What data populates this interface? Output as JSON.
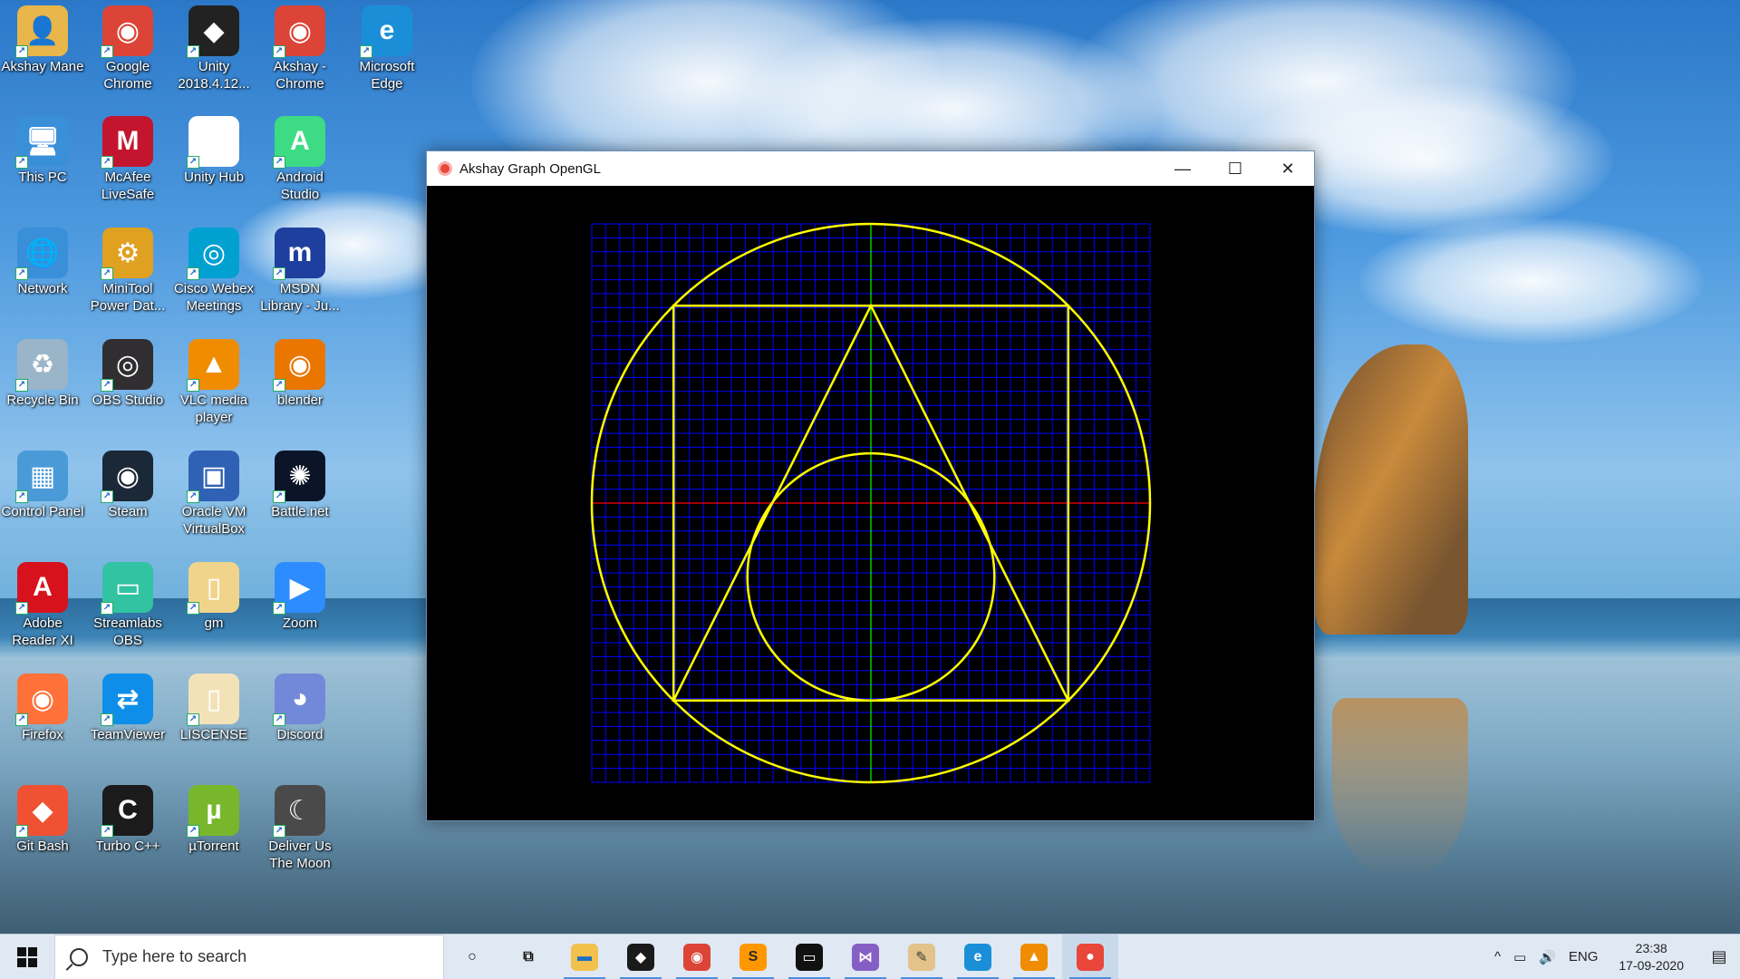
{
  "desktop": {
    "icons": [
      {
        "label": "Akshay Mane",
        "icon": "user-folder-icon",
        "color": "#e8b64a",
        "sym": "👤"
      },
      {
        "label": "Google Chrome",
        "icon": "chrome-icon",
        "color": "#db4437",
        "sym": "◉"
      },
      {
        "label": "Unity 2018.4.12...",
        "icon": "unity-icon",
        "color": "#222222",
        "sym": "◆"
      },
      {
        "label": "Akshay - Chrome",
        "icon": "chrome-profile-icon",
        "color": "#db4437",
        "sym": "◉"
      },
      {
        "label": "Microsoft Edge",
        "icon": "edge-icon",
        "color": "#1a8fd8",
        "sym": "e"
      },
      {
        "label": "This PC",
        "icon": "computer-icon",
        "color": "#3a8fd9",
        "sym": "🖥"
      },
      {
        "label": "McAfee LiveSafe",
        "icon": "mcafee-icon",
        "color": "#c3162e",
        "sym": "M"
      },
      {
        "label": "Unity Hub",
        "icon": "unity-hub-icon",
        "color": "#ffffff",
        "sym": "◆"
      },
      {
        "label": "Android Studio",
        "icon": "android-studio-icon",
        "color": "#3ddc84",
        "sym": "A"
      },
      {
        "label": "Network",
        "icon": "network-icon",
        "color": "#3a8fd9",
        "sym": "🌐"
      },
      {
        "label": "MiniTool Power Dat...",
        "icon": "minitool-icon",
        "color": "#e0a020",
        "sym": "⚙"
      },
      {
        "label": "Cisco Webex Meetings",
        "icon": "webex-icon",
        "color": "#00a0d1",
        "sym": "◎"
      },
      {
        "label": "MSDN Library - Ju...",
        "icon": "msdn-icon",
        "color": "#1e3f9e",
        "sym": "m"
      },
      {
        "label": "Recycle Bin",
        "icon": "recycle-bin-icon",
        "color": "#9ab4c8",
        "sym": "♻"
      },
      {
        "label": "OBS Studio",
        "icon": "obs-icon",
        "color": "#302e31",
        "sym": "◎"
      },
      {
        "label": "VLC media player",
        "icon": "vlc-icon",
        "color": "#f08c00",
        "sym": "▲"
      },
      {
        "label": "blender",
        "icon": "blender-icon",
        "color": "#ea7600",
        "sym": "◉"
      },
      {
        "label": "Control Panel",
        "icon": "control-panel-icon",
        "color": "#4a9ad8",
        "sym": "▦"
      },
      {
        "label": "Steam",
        "icon": "steam-icon",
        "color": "#1b2838",
        "sym": "◉"
      },
      {
        "label": "Oracle VM VirtualBox",
        "icon": "virtualbox-icon",
        "color": "#2f61b4",
        "sym": "▣"
      },
      {
        "label": "Battle.net",
        "icon": "battlenet-icon",
        "color": "#0c1428",
        "sym": "✺"
      },
      {
        "label": "Adobe Reader XI",
        "icon": "adobe-reader-icon",
        "color": "#d7121d",
        "sym": "A"
      },
      {
        "label": "Streamlabs OBS",
        "icon": "streamlabs-icon",
        "color": "#31c3a2",
        "sym": "▭"
      },
      {
        "label": "gm",
        "icon": "file-icon",
        "color": "#f1d48b",
        "sym": "▯"
      },
      {
        "label": "Zoom",
        "icon": "zoom-icon",
        "color": "#2d8cff",
        "sym": "▶"
      },
      {
        "label": "Firefox",
        "icon": "firefox-icon",
        "color": "#ff7139",
        "sym": "◉"
      },
      {
        "label": "TeamViewer",
        "icon": "teamviewer-icon",
        "color": "#0e8ee9",
        "sym": "⇄"
      },
      {
        "label": "LISCENSE",
        "icon": "pdf-file-icon",
        "color": "#f3e2b8",
        "sym": "▯"
      },
      {
        "label": "Discord",
        "icon": "discord-icon",
        "color": "#7289da",
        "sym": "◕"
      },
      {
        "label": "Git Bash",
        "icon": "git-bash-icon",
        "color": "#f05133",
        "sym": "◆"
      },
      {
        "label": "Turbo C++",
        "icon": "turbo-cpp-icon",
        "color": "#1b1b1b",
        "sym": "C"
      },
      {
        "label": "µTorrent",
        "icon": "utorrent-icon",
        "color": "#78b72c",
        "sym": "µ"
      },
      {
        "label": "Deliver Us The Moon",
        "icon": "deliver-us-the-moon-icon",
        "color": "#4a4a4a",
        "sym": "☾"
      }
    ]
  },
  "window": {
    "title": "Akshay Graph OpenGL",
    "minimize": "—",
    "maximize": "☐",
    "close": "✕"
  },
  "graph": {
    "background": "#000000",
    "grid_color": "#0000ff",
    "x_axis_color": "#ff0000",
    "y_axis_color": "#00ff00",
    "shape_color": "#ffff00",
    "grid_range": [
      -20,
      20
    ],
    "outer_circle_radius": 20,
    "square_half_side": 14.14,
    "triangle": [
      [
        0,
        14.14
      ],
      [
        -14.14,
        -14.14
      ],
      [
        14.14,
        -14.14
      ]
    ],
    "inner_circle": {
      "cx": 0,
      "cy": -5.29,
      "r": 8.85
    }
  },
  "taskbar": {
    "search_placeholder": "Type here to search",
    "apps": [
      {
        "name": "cortana-icon",
        "sym": "○",
        "color": "#dfe8f3",
        "fg": "#111"
      },
      {
        "name": "task-view-icon",
        "sym": "⧉",
        "color": "#dfe8f3",
        "fg": "#111"
      },
      {
        "name": "file-explorer-icon",
        "sym": "▬",
        "color": "#f2c04d",
        "fg": "#1a6fc2"
      },
      {
        "name": "predator-sense-icon",
        "sym": "◆",
        "color": "#1a1a1a",
        "fg": "#ffffff"
      },
      {
        "name": "chrome-icon",
        "sym": "◉",
        "color": "#db4437",
        "fg": "#ffffff"
      },
      {
        "name": "sublime-text-icon",
        "sym": "S",
        "color": "#ff9800",
        "fg": "#2b2b2b"
      },
      {
        "name": "terminal-icon",
        "sym": "▭",
        "color": "#111111",
        "fg": "#ffffff"
      },
      {
        "name": "visual-studio-icon",
        "sym": "⋈",
        "color": "#865fc5",
        "fg": "#ffffff"
      },
      {
        "name": "paint-icon",
        "sym": "✎",
        "color": "#e3c38a",
        "fg": "#3a3a3a"
      },
      {
        "name": "edge-icon",
        "sym": "e",
        "color": "#1a8fd8",
        "fg": "#ffffff"
      },
      {
        "name": "vlc-icon",
        "sym": "▲",
        "color": "#f08c00",
        "fg": "#ffffff"
      },
      {
        "name": "opengl-app-icon",
        "sym": "●",
        "color": "#e8473a",
        "fg": "#ffffff"
      }
    ],
    "tray": {
      "chevron": "^",
      "battery": "▭",
      "volume": "🔊",
      "language": "ENG",
      "time": "23:38",
      "date": "17-09-2020",
      "notifications": "▤"
    }
  }
}
